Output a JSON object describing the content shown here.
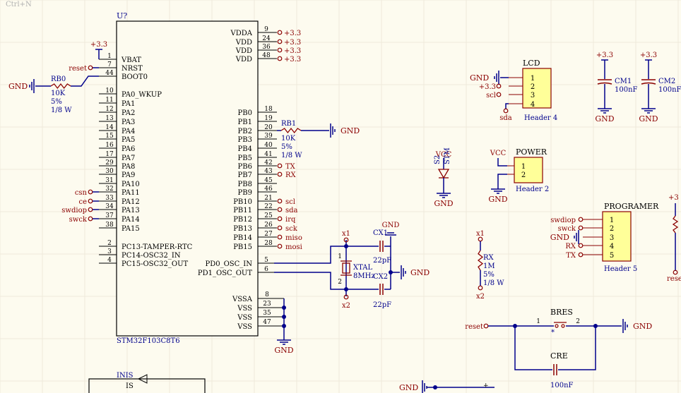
{
  "hint": "Ctrl+N",
  "mcu": {
    "designator": "U?",
    "part": "STM32F103C8T6",
    "left_pins": [
      {
        "num": "1",
        "name": "VBAT",
        "net": "+3.3"
      },
      {
        "num": "7",
        "name": "NRST",
        "net": "reset"
      },
      {
        "num": "44",
        "name": "BOOT0",
        "net": ""
      },
      {
        "num": "10",
        "name": "PA0_WKUP",
        "net": ""
      },
      {
        "num": "11",
        "name": "PA1",
        "net": ""
      },
      {
        "num": "12",
        "name": "PA2",
        "net": ""
      },
      {
        "num": "13",
        "name": "PA3",
        "net": ""
      },
      {
        "num": "14",
        "name": "PA4",
        "net": ""
      },
      {
        "num": "15",
        "name": "PA5",
        "net": ""
      },
      {
        "num": "16",
        "name": "PA6",
        "net": ""
      },
      {
        "num": "17",
        "name": "PA7",
        "net": ""
      },
      {
        "num": "29",
        "name": "PA8",
        "net": ""
      },
      {
        "num": "30",
        "name": "PA9",
        "net": ""
      },
      {
        "num": "31",
        "name": "PA10",
        "net": ""
      },
      {
        "num": "32",
        "name": "PA11",
        "net": "csn"
      },
      {
        "num": "33",
        "name": "PA12",
        "net": "ce"
      },
      {
        "num": "34",
        "name": "PA13",
        "net": "swdiop"
      },
      {
        "num": "37",
        "name": "PA14",
        "net": "swck"
      },
      {
        "num": "38",
        "name": "PA15",
        "net": ""
      },
      {
        "num": "2",
        "name": "PC13-TAMPER-RTC",
        "net": ""
      },
      {
        "num": "3",
        "name": "PC14-OSC32_IN",
        "net": ""
      },
      {
        "num": "4",
        "name": "PC15-OSC32_OUT",
        "net": ""
      }
    ],
    "power_pins": [
      {
        "num": "9",
        "name": "VDDA",
        "net": "+3.3"
      },
      {
        "num": "24",
        "name": "VDD",
        "net": "+3.3"
      },
      {
        "num": "36",
        "name": "VDD",
        "net": "+3.3"
      },
      {
        "num": "48",
        "name": "VDD",
        "net": "+3.3"
      }
    ],
    "pb_pins": [
      {
        "num": "18",
        "name": "PB0",
        "net": ""
      },
      {
        "num": "19",
        "name": "PB1",
        "net": ""
      },
      {
        "num": "20",
        "name": "PB2",
        "net": ""
      },
      {
        "num": "39",
        "name": "PB3",
        "net": ""
      },
      {
        "num": "40",
        "name": "PB4",
        "net": ""
      },
      {
        "num": "41",
        "name": "PB5",
        "net": ""
      },
      {
        "num": "42",
        "name": "PB6",
        "net": "TX"
      },
      {
        "num": "43",
        "name": "PB7",
        "net": "RX"
      },
      {
        "num": "45",
        "name": "PB8",
        "net": ""
      },
      {
        "num": "46",
        "name": "PB9",
        "net": ""
      },
      {
        "num": "21",
        "name": "PB10",
        "net": "scl"
      },
      {
        "num": "22",
        "name": "PB11",
        "net": "sda"
      },
      {
        "num": "25",
        "name": "PB12",
        "net": "irq"
      },
      {
        "num": "26",
        "name": "PB13",
        "net": "sck"
      },
      {
        "num": "27",
        "name": "PB14",
        "net": "miso"
      },
      {
        "num": "28",
        "name": "PB15",
        "net": "mosi"
      }
    ],
    "osc_pins": [
      {
        "num": "5",
        "name": "PD0_OSC_IN"
      },
      {
        "num": "6",
        "name": "PD1_OSC_OUT"
      }
    ],
    "gnd_pins": [
      {
        "num": "8",
        "name": "VSSA"
      },
      {
        "num": "23",
        "name": "VSS"
      },
      {
        "num": "35",
        "name": "VSS"
      },
      {
        "num": "47",
        "name": "VSS"
      }
    ]
  },
  "rb0": {
    "designator": "RB0",
    "value": "10K",
    "tolerance": "5%",
    "power": "1/8 W"
  },
  "rb1": {
    "designator": "RB1",
    "value": "10K",
    "tolerance": "5%",
    "power": "1/8 W"
  },
  "xtal": {
    "designator": "XTAL",
    "value": "8MHz",
    "pin1": "1",
    "pin2": "2",
    "net1": "x1",
    "net2": "x2"
  },
  "cx1": {
    "designator": "CX1",
    "value": "22pF"
  },
  "cx2": {
    "designator": "CX2",
    "value": "22pF"
  },
  "lcd": {
    "designator": "LCD",
    "part": "Header 4",
    "pins": [
      "1",
      "2",
      "3",
      "4"
    ],
    "nets": [
      "GND",
      "+3.3",
      "scl",
      "sda"
    ]
  },
  "cm1": {
    "designator": "CM1",
    "value": "100nF"
  },
  "cm2": {
    "designator": "CM2",
    "value": "100nF"
  },
  "s2": {
    "designator": "S2",
    "value": "STM"
  },
  "power_hdr": {
    "designator": "POWER",
    "part": "Header 2",
    "pins": [
      "1",
      "2"
    ],
    "nets": [
      "VCC",
      ""
    ]
  },
  "rx_res": {
    "designator": "RX",
    "value": "1M",
    "tolerance": "5%",
    "power": "1/8 W",
    "net_top": "x1",
    "net_bottom": "x2"
  },
  "programmer": {
    "designator": "PROGRAMER",
    "part": "Header 5",
    "pins": [
      "1",
      "2",
      "3",
      "4",
      "5"
    ],
    "nets": [
      "swdiop",
      "swck",
      "GND",
      "RX",
      "TX"
    ]
  },
  "bres": {
    "designator": "BRES",
    "pin1": "1",
    "pin2": "2",
    "mark": "*"
  },
  "cre": {
    "designator": "CRE",
    "value": "100nF"
  },
  "misc": {
    "gnd": "GND",
    "vcc": "VCC",
    "plus33": "+3.3",
    "reset": "reset",
    "right_edge_net": "+3",
    "right_edge_net2": "rese",
    "bottom_part": "INIS",
    "bottom_pin": "IS",
    "bottom_plus": "+"
  },
  "colors": {
    "wire": "#00008b",
    "part_line": "#8b0000",
    "label": "#8b0000",
    "designator": "#00008b",
    "part_fill": "#ffff99",
    "background": "#fdfbef"
  }
}
